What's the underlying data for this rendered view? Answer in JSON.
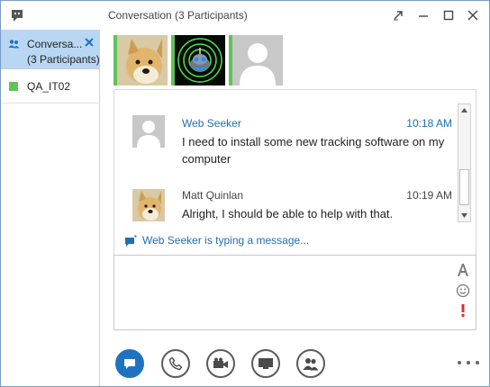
{
  "window": {
    "title": "Conversation (3 Participants)"
  },
  "title_buttons": [
    "pop-out",
    "minimize",
    "maximize",
    "close"
  ],
  "sidebar": {
    "items": [
      {
        "label_line1": "Conversa...",
        "label_line2": "(3 Participants)",
        "icon": "group-icon",
        "selected": true
      },
      {
        "label_line1": "QA_IT02",
        "icon": "presence-available",
        "presence_color": "#5fc35a"
      }
    ]
  },
  "participants": [
    {
      "avatar": "doge-photo",
      "presence_color": "#5fc35a"
    },
    {
      "avatar": "radar-robot-photo",
      "presence_color": "#5fc35a"
    },
    {
      "avatar": "default-person-silhouette",
      "presence_color": "#5fc35a"
    }
  ],
  "messages": [
    {
      "sender": "Web Seeker",
      "time": "10:18 AM",
      "text": "I need to install some new tracking software on my computer",
      "sender_color": "#1e6fb5",
      "avatar": "default-person-silhouette"
    },
    {
      "sender": "Matt Quinlan",
      "time": "10:19 AM",
      "text": "Alright, I should be able to help with that.",
      "sender_color": "#444444",
      "avatar": "doge-photo"
    }
  ],
  "typing_indicator": "Web Seeker is typing a message...",
  "compose": {
    "value": "",
    "tools": [
      "font-icon",
      "emoticon-icon",
      "high-importance-icon"
    ]
  },
  "toolbar": {
    "buttons": [
      "im-icon",
      "phone-icon",
      "video-icon",
      "present-icon",
      "participants-icon"
    ],
    "more": "more-options-icon"
  },
  "colors": {
    "accent": "#1e73c0",
    "presence_available": "#5fc35a",
    "selected_bg": "#b9d7f2",
    "importance": "#d6342a"
  }
}
